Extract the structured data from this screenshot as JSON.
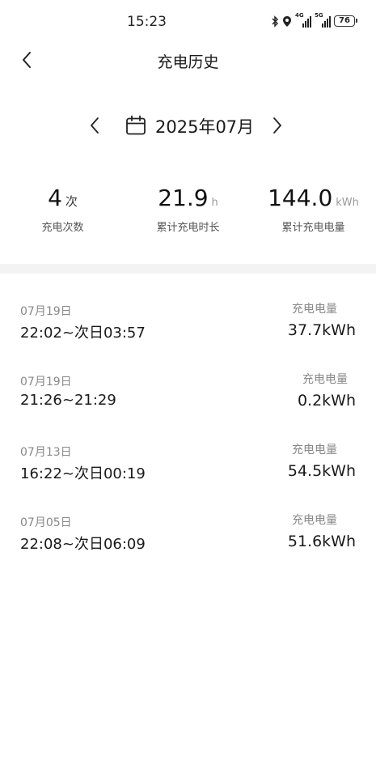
{
  "status_bar": {
    "time": "15:23",
    "network_1": "4G",
    "network_2": "5G",
    "battery": "76",
    "icons": [
      "bluetooth-icon",
      "location-icon",
      "signal-icon",
      "signal-icon",
      "battery-icon"
    ]
  },
  "header": {
    "title": "充电历史",
    "back_icon": "chevron-left-icon"
  },
  "month_selector": {
    "label": "2025年07月",
    "prev_icon": "chevron-left-icon",
    "next_icon": "chevron-right-icon",
    "calendar_icon": "calendar-icon"
  },
  "stats": [
    {
      "value": "4",
      "unit": "次",
      "label": "充电次数"
    },
    {
      "value": "21.9",
      "unit": "h",
      "label": "累计充电时长"
    },
    {
      "value": "144.0",
      "unit": "kWh",
      "label": "累计充电电量"
    }
  ],
  "records": [
    {
      "date": "07月19日",
      "time": "22:02~次日03:57",
      "label": "充电电量",
      "value": "37.7kWh"
    },
    {
      "date": "07月19日",
      "time": "21:26~21:29",
      "label": "充电电量",
      "value": "0.2kWh"
    },
    {
      "date": "07月13日",
      "time": "16:22~次日00:19",
      "label": "充电电量",
      "value": "54.5kWh"
    },
    {
      "date": "07月05日",
      "time": "22:08~次日06:09",
      "label": "充电电量",
      "value": "51.6kWh"
    }
  ],
  "colors": {
    "background": "#ffffff",
    "divider": "#f3f3f3",
    "primary_text": "#1a1a1a",
    "secondary_text": "#888888"
  }
}
